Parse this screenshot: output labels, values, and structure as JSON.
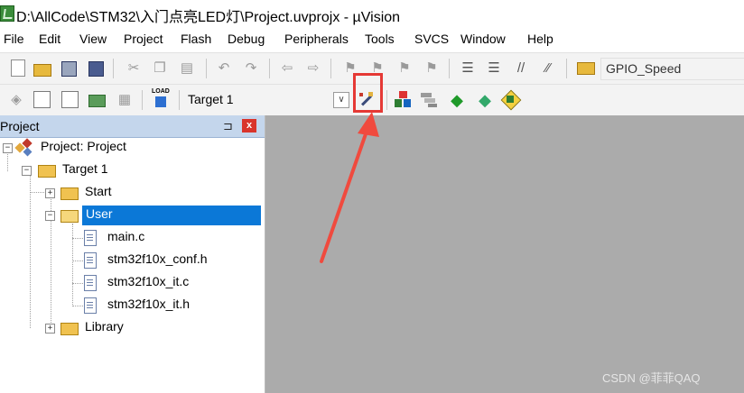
{
  "window": {
    "title": "D:\\AllCode\\STM32\\入门点亮LED灯\\Project.uvprojx - µVision",
    "icon": "uvision-app-icon"
  },
  "menu": [
    "File",
    "Edit",
    "View",
    "Project",
    "Flash",
    "Debug",
    "Peripherals",
    "Tools",
    "SVCS",
    "Window",
    "Help"
  ],
  "toolbar1": {
    "find_text": "GPIO_Speed"
  },
  "toolbar2": {
    "load_label": "LOAD",
    "target": "Target 1",
    "highlighted_button": "options-for-target-icon"
  },
  "project_panel": {
    "title": "Project",
    "pin": "⊐",
    "close": "x",
    "tree": [
      {
        "label": "Project: Project"
      },
      {
        "label": "Target 1"
      },
      {
        "label": "Start"
      },
      {
        "label": "User"
      },
      {
        "label": "main.c"
      },
      {
        "label": "stm32f10x_conf.h"
      },
      {
        "label": "stm32f10x_it.c"
      },
      {
        "label": "stm32f10x_it.h"
      },
      {
        "label": "Library"
      }
    ]
  },
  "watermark": "CSDN @菲菲QAQ",
  "colors": {
    "accent_selection": "#0b78d7",
    "highlight": "#e53935",
    "editor_bg": "#ababab"
  }
}
